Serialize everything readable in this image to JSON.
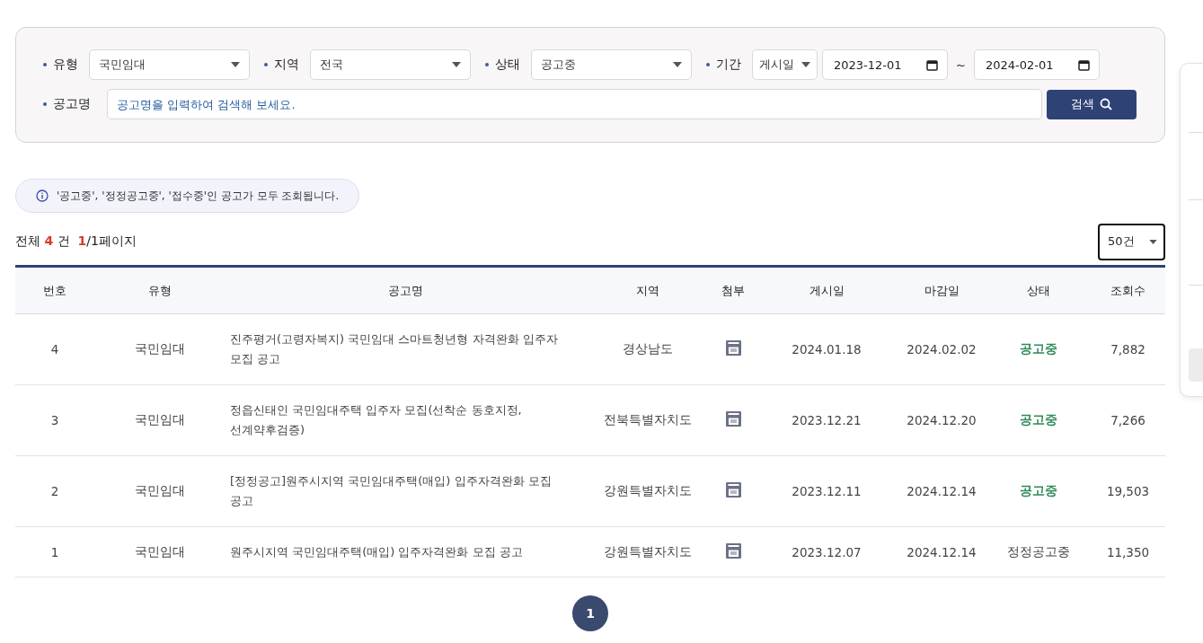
{
  "search": {
    "filters": [
      {
        "label": "유형",
        "kind": "select",
        "value": "국민임대"
      },
      {
        "label": "지역",
        "kind": "select",
        "value": "전국"
      },
      {
        "label": "상태",
        "kind": "select",
        "value": "공고중"
      },
      {
        "label": "기간",
        "kind": "period",
        "basis": "게시일",
        "from": "2023-12-01",
        "separator": "~",
        "to": "2024-02-01"
      }
    ],
    "name_label": "공고명",
    "placeholder": "공고명을 입력하여 검색해 보세요.",
    "button": "검색"
  },
  "notice": "'공고중', '정정공고중', '접수중'인 공고가 모두 조회됩니다.",
  "summary": {
    "prefix": "전체",
    "total": "4",
    "unit": "건",
    "page": "1",
    "page_rest": "/1페이지"
  },
  "page_size": "50건",
  "table": {
    "columns": [
      "번호",
      "유형",
      "공고명",
      "지역",
      "첨부",
      "게시일",
      "마감일",
      "상태",
      "조회수"
    ],
    "rows": [
      {
        "no": "4",
        "type": "국민임대",
        "title": "진주평거(고령자복지) 국민임대 스마트청년형 자격완화 입주자 모집 공고",
        "region": "경상남도",
        "posted": "2024.01.18",
        "deadline": "2024.02.02",
        "status": "공고중",
        "highlighted": true,
        "views": "7,882"
      },
      {
        "no": "3",
        "type": "국민임대",
        "title": "정읍신태인 국민임대주택 입주자 모집(선착순 동호지정, 선계약후검증)",
        "region": "전북특별자치도",
        "posted": "2023.12.21",
        "deadline": "2024.12.20",
        "status": "공고중",
        "highlighted": true,
        "views": "7,266"
      },
      {
        "no": "2",
        "type": "국민임대",
        "title": "[정정공고]원주시지역 국민임대주택(매입) 입주자격완화 모집 공고",
        "region": "강원특별자치도",
        "posted": "2023.12.11",
        "deadline": "2024.12.14",
        "status": "공고중",
        "highlighted": true,
        "views": "19,503"
      },
      {
        "no": "1",
        "type": "국민임대",
        "title": "원주시지역 국민임대주택(매입) 입주자격완화 모집 공고",
        "region": "강원특별자치도",
        "posted": "2023.12.07",
        "deadline": "2024.12.14",
        "status": "정정공고중",
        "highlighted": false,
        "views": "11,350"
      }
    ]
  },
  "pagination": [
    {
      "label": "1",
      "selected": true
    }
  ]
}
